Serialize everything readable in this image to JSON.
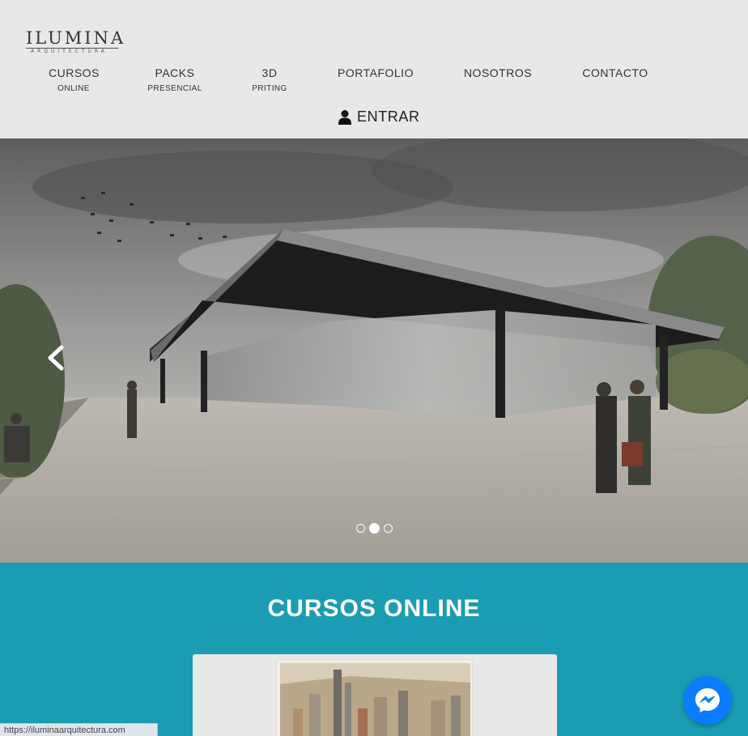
{
  "logo": {
    "main": "ILUMINA",
    "sub": "ARQUITECTURA"
  },
  "nav": {
    "items": [
      {
        "label": "CURSOS",
        "sub": "ONLINE"
      },
      {
        "label": "PACKS",
        "sub": "PRESENCIAL"
      },
      {
        "label": "3D",
        "sub": "PRITING"
      },
      {
        "label": "PORTAFOLIO",
        "sub": ""
      },
      {
        "label": "NOSOTROS",
        "sub": ""
      },
      {
        "label": "CONTACTO",
        "sub": ""
      }
    ],
    "login_label": "ENTRAR"
  },
  "hero": {
    "slide_count": 3,
    "active_slide": 2,
    "prev_icon": "chevron-left-icon"
  },
  "courses": {
    "title": "CURSOS ONLINE"
  },
  "status_url": "https://iluminaarquitectura.com",
  "colors": {
    "header_bg": "#e8e8e8",
    "accent": "#1a9db3",
    "messenger": "#0a7cff"
  }
}
